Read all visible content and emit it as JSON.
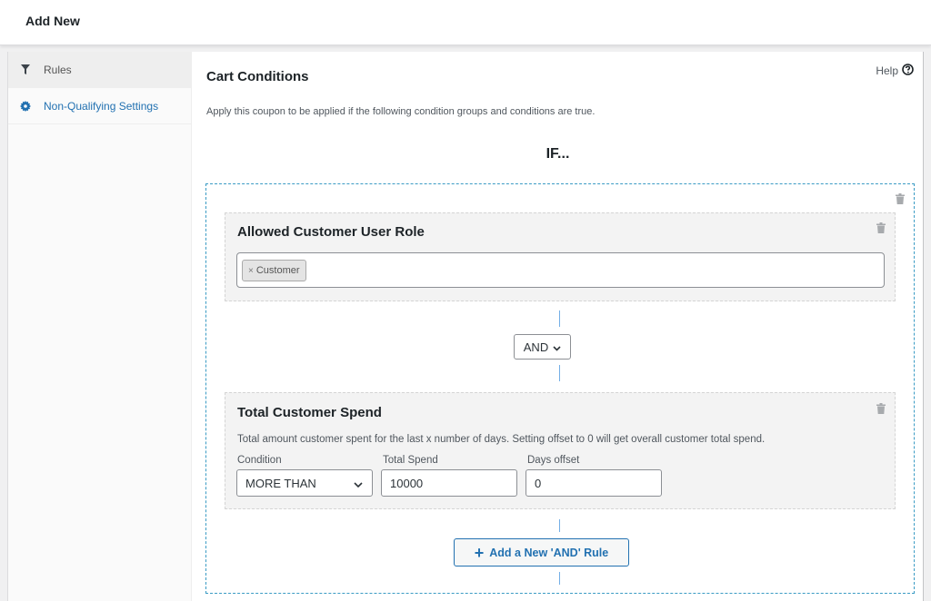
{
  "header": {
    "title": "Add New"
  },
  "sidebar": {
    "items": [
      {
        "label": "Rules",
        "icon": "filter-icon",
        "active": true
      },
      {
        "label": "Non-Qualifying Settings",
        "icon": "gear-icon",
        "active": false
      }
    ]
  },
  "main": {
    "title": "Cart Conditions",
    "help_label": "Help",
    "description": "Apply this coupon to be applied if the following condition groups and conditions are true.",
    "if_label": "IF...",
    "group": {
      "conditions": [
        {
          "title": "Allowed Customer User Role",
          "selected_roles": [
            "Customer"
          ],
          "remove_symbol": "×"
        },
        {
          "title": "Total Customer Spend",
          "description": "Total amount customer spent for the last x number of days. Setting offset to 0 will get overall customer total spend.",
          "fields": {
            "condition_label": "Condition",
            "condition_value": "MORE THAN",
            "total_spend_label": "Total Spend",
            "total_spend_value": "10000",
            "days_offset_label": "Days offset",
            "days_offset_value": "0"
          }
        }
      ],
      "logic_operator": "AND",
      "add_rule_label": "Add a New 'AND' Rule"
    }
  },
  "colors": {
    "accent": "#2271b1",
    "group_border": "#3a9bc4",
    "condition_bg": "#f3f3f3"
  }
}
